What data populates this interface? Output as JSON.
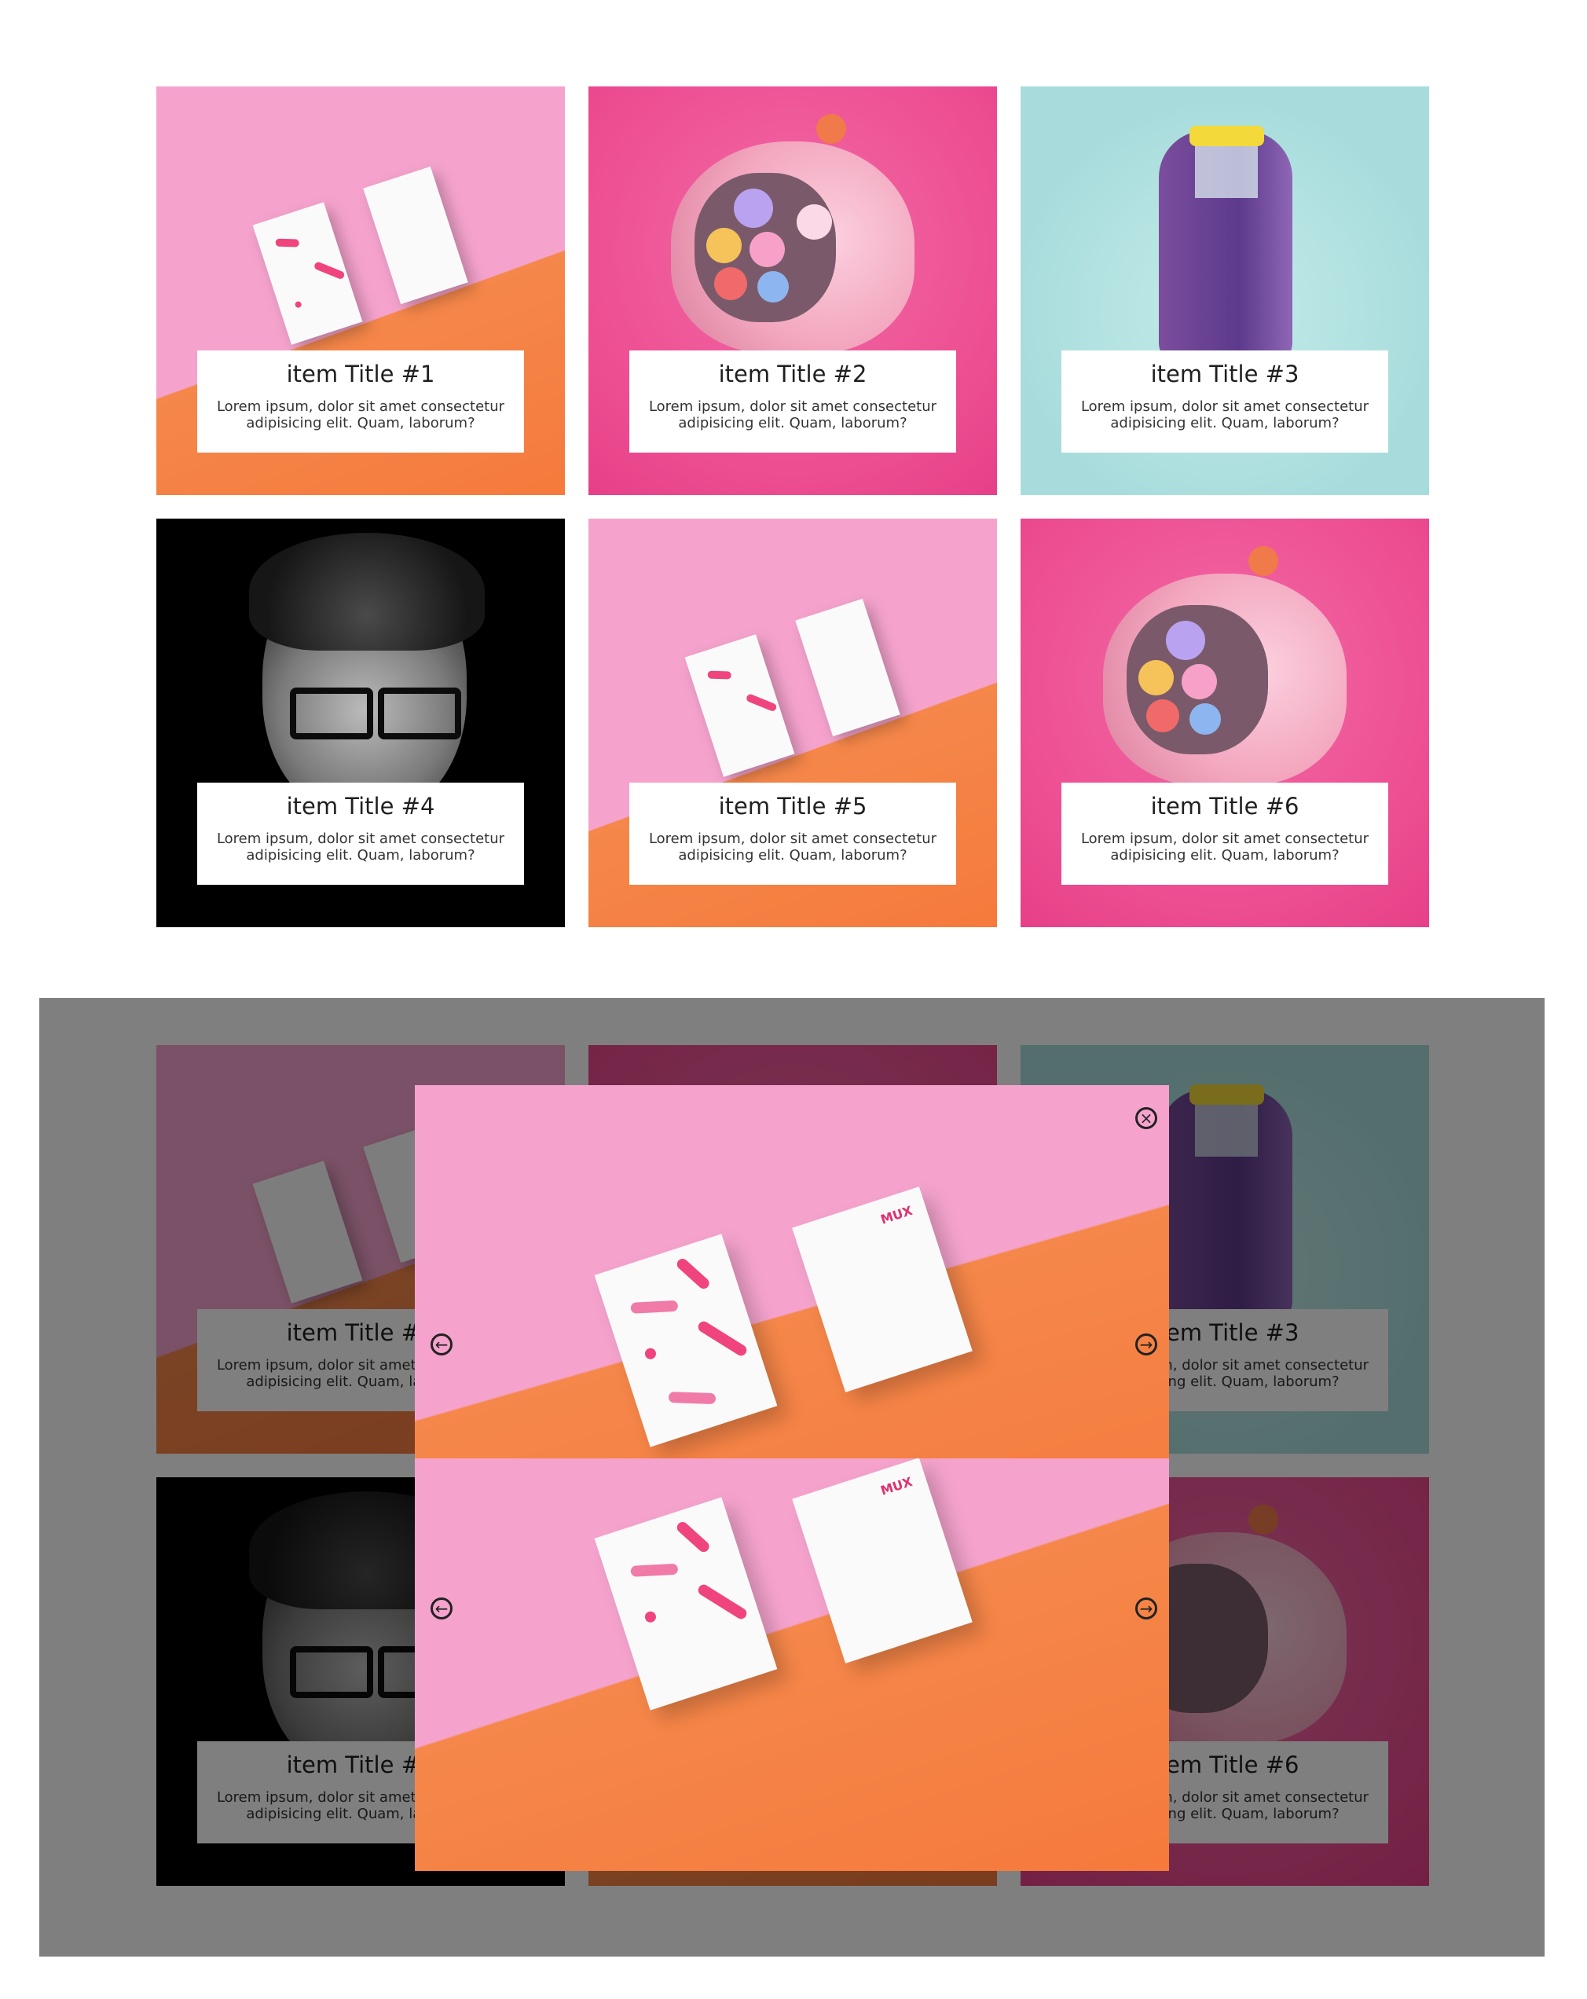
{
  "gallery": {
    "items": [
      {
        "title": "item Title #1",
        "desc": "Lorem ipsum, dolor sit amet consectetur adipisicing elit. Quam, laborum?"
      },
      {
        "title": "item Title #2",
        "desc": "Lorem ipsum, dolor sit amet consectetur adipisicing elit. Quam, laborum?"
      },
      {
        "title": "item Title #3",
        "desc": "Lorem ipsum, dolor sit amet consectetur adipisicing elit. Quam, laborum?"
      },
      {
        "title": "item Title #4",
        "desc": "Lorem ipsum, dolor sit amet consectetur adipisicing elit. Quam, laborum?"
      },
      {
        "title": "item Title #5",
        "desc": "Lorem ipsum, dolor sit amet consectetur adipisicing elit. Quam, laborum?"
      },
      {
        "title": "item Title #6",
        "desc": "Lorem ipsum, dolor sit amet consectetur adipisicing elit. Quam, laborum?"
      }
    ]
  },
  "lightbox": {
    "close_icon": "×",
    "prev_icon": "←",
    "next_icon": "→",
    "brand_mark": "MUX"
  },
  "colors": {
    "overlay": "#000000",
    "pink": "#f5a3cd",
    "orange": "#f5874a",
    "magenta": "#ed4d91",
    "mint": "#a8dcdc"
  }
}
